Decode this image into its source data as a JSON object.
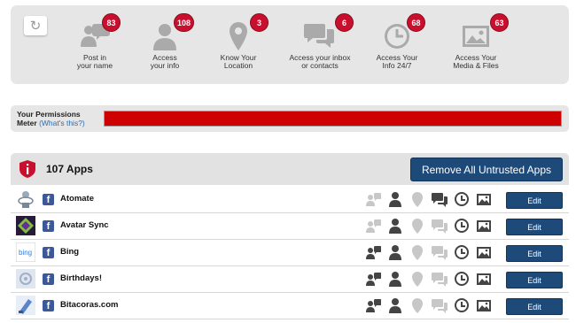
{
  "permissions": {
    "refresh_glyph": "↻",
    "items": [
      {
        "label_line1": "Post in",
        "label_line2": "your name",
        "count": "83",
        "icon": "speech-people-icon"
      },
      {
        "label_line1": "Access",
        "label_line2": "your info",
        "count": "108",
        "icon": "person-icon"
      },
      {
        "label_line1": "Know Your",
        "label_line2": "Location",
        "count": "3",
        "icon": "location-pin-icon"
      },
      {
        "label_line1": "Access your inbox",
        "label_line2": "or contacts",
        "count": "6",
        "icon": "chat-bubbles-icon"
      },
      {
        "label_line1": "Access Your",
        "label_line2": "Info 24/7",
        "count": "68",
        "icon": "clock-icon"
      },
      {
        "label_line1": "Access Your",
        "label_line2": "Media & Files",
        "count": "63",
        "icon": "picture-icon"
      }
    ]
  },
  "meter": {
    "label_line1": "Your Permissions",
    "label_line2": "Meter",
    "link": "(What's this?)",
    "level_fraction": 1.0,
    "fill_color": "#cf0000"
  },
  "apps": {
    "count_label": "107 Apps",
    "remove_button": "Remove All Untrusted Apps",
    "edit_label": "Edit",
    "rows": [
      {
        "name": "Atomate",
        "thumb": "atomate-logo",
        "permissions": [
          false,
          true,
          false,
          true,
          true,
          true
        ]
      },
      {
        "name": "Avatar Sync",
        "thumb": "avatar-sync-logo",
        "permissions": [
          false,
          true,
          false,
          false,
          true,
          true
        ]
      },
      {
        "name": "Bing",
        "thumb": "bing-logo",
        "permissions": [
          true,
          true,
          false,
          false,
          true,
          true
        ]
      },
      {
        "name": "Birthdays!",
        "thumb": "birthdays-logo",
        "permissions": [
          true,
          true,
          false,
          false,
          true,
          true
        ]
      },
      {
        "name": "Bitacoras.com",
        "thumb": "bitacoras-logo",
        "permissions": [
          true,
          true,
          false,
          false,
          true,
          true
        ]
      }
    ]
  },
  "colors": {
    "badge_red": "#c8102e",
    "button_blue": "#1e4a7a",
    "facebook_blue": "#3b5998"
  }
}
